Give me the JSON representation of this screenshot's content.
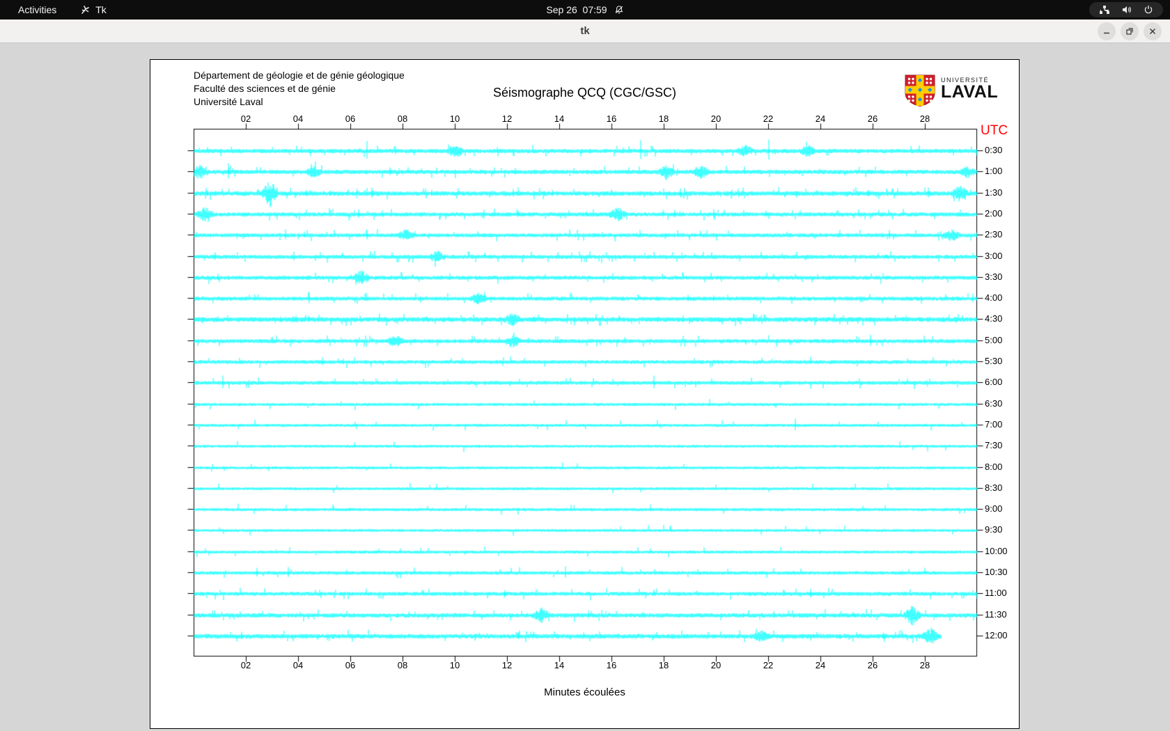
{
  "panel": {
    "activities": "Activities",
    "app_name": "Tk",
    "clock": "Sep 26  07:59"
  },
  "window": {
    "title": "tk"
  },
  "header": {
    "line1": "Département de géologie et de génie géologique",
    "line2": "Faculté des sciences et de génie",
    "line3": "Université Laval"
  },
  "logo": {
    "small": "UNIVERSITÉ",
    "large": "LAVAL"
  },
  "plot": {
    "title": "Séismographe QCQ (CGC/GSC)",
    "utc_label": "UTC",
    "xlabel": "Minutes écoulées",
    "colors": {
      "trace": "#00ffff",
      "utc": "#ff0000",
      "axis": "#000000"
    }
  },
  "chart_data": {
    "type": "seismograph-heliplot",
    "title": "Séismographe QCQ (CGC/GSC)",
    "xlabel": "Minutes écoulées",
    "x_range_minutes": [
      0,
      30
    ],
    "x_tick_labels": [
      "02",
      "04",
      "06",
      "08",
      "10",
      "12",
      "14",
      "16",
      "18",
      "20",
      "22",
      "24",
      "26",
      "28"
    ],
    "y_axis_right_label": "UTC",
    "trace_color": "#00ffff",
    "rows": [
      {
        "label": "0:30",
        "noise": 1.5,
        "micro": 0.05,
        "events": [
          [
            6.6,
            14,
            "s"
          ],
          [
            7.7,
            6,
            "s"
          ],
          [
            10.0,
            5,
            "b"
          ],
          [
            17.1,
            15,
            "s"
          ],
          [
            21.1,
            4,
            "b"
          ],
          [
            22.0,
            16,
            "s"
          ],
          [
            23.5,
            4,
            "b"
          ]
        ]
      },
      {
        "label": "1:00",
        "noise": 1.5,
        "micro": 0.05,
        "events": [
          [
            0.2,
            5,
            "b"
          ],
          [
            1.3,
            12,
            "s"
          ],
          [
            4.6,
            4,
            "b"
          ],
          [
            7.5,
            6,
            "s"
          ],
          [
            18.1,
            5,
            "b"
          ],
          [
            19.4,
            5,
            "b"
          ],
          [
            29.6,
            4,
            "b"
          ]
        ]
      },
      {
        "label": "1:30",
        "noise": 1.7,
        "micro": 0.06,
        "events": [
          [
            0.5,
            5,
            "s"
          ],
          [
            2.9,
            10,
            "b"
          ],
          [
            4.3,
            5,
            "s"
          ],
          [
            5.2,
            4,
            "s"
          ],
          [
            6.8,
            8,
            "s"
          ],
          [
            9.1,
            5,
            "s"
          ],
          [
            12.2,
            6,
            "s"
          ],
          [
            13.7,
            5,
            "s"
          ],
          [
            18.6,
            7,
            "s"
          ],
          [
            25.8,
            5,
            "s"
          ],
          [
            28.1,
            8,
            "s"
          ],
          [
            29.3,
            6,
            "b"
          ]
        ]
      },
      {
        "label": "2:00",
        "noise": 1.5,
        "micro": 0.05,
        "events": [
          [
            0.4,
            5,
            "b"
          ],
          [
            6.3,
            7,
            "s"
          ],
          [
            7.2,
            5,
            "s"
          ],
          [
            11.1,
            6,
            "s"
          ],
          [
            12.4,
            5,
            "s"
          ],
          [
            15.0,
            4,
            "s"
          ],
          [
            16.2,
            5,
            "b"
          ],
          [
            18.4,
            6,
            "s"
          ],
          [
            19.9,
            7,
            "s"
          ],
          [
            21.9,
            5,
            "s"
          ]
        ]
      },
      {
        "label": "2:30",
        "noise": 1.4,
        "micro": 0.04,
        "events": [
          [
            3.5,
            8,
            "s"
          ],
          [
            4.2,
            5,
            "s"
          ],
          [
            6.6,
            8,
            "s"
          ],
          [
            8.1,
            4,
            "b"
          ],
          [
            26.6,
            7,
            "s"
          ],
          [
            29.0,
            4,
            "b"
          ]
        ]
      },
      {
        "label": "3:00",
        "noise": 1.4,
        "micro": 0.04,
        "events": [
          [
            0.8,
            6,
            "s"
          ],
          [
            3.8,
            7,
            "s"
          ],
          [
            9.3,
            4,
            "b"
          ],
          [
            26.5,
            3,
            "s"
          ]
        ]
      },
      {
        "label": "3:30",
        "noise": 1.4,
        "micro": 0.04,
        "events": [
          [
            0.9,
            5,
            "s"
          ],
          [
            6.0,
            4,
            "s"
          ],
          [
            6.4,
            5,
            "b"
          ]
        ]
      },
      {
        "label": "4:00",
        "noise": 1.4,
        "micro": 0.04,
        "events": [
          [
            4.4,
            9,
            "s"
          ],
          [
            10.9,
            4,
            "b"
          ],
          [
            18.9,
            5,
            "s"
          ],
          [
            19.9,
            4,
            "s"
          ],
          [
            29.8,
            7,
            "s"
          ]
        ]
      },
      {
        "label": "4:30",
        "noise": 1.8,
        "micro": 0.07,
        "events": [
          [
            3.3,
            4,
            "s"
          ],
          [
            3.9,
            5,
            "s"
          ],
          [
            4.4,
            4,
            "s"
          ],
          [
            12.2,
            4,
            "b"
          ],
          [
            13.0,
            4,
            "s"
          ]
        ]
      },
      {
        "label": "5:00",
        "noise": 1.4,
        "micro": 0.04,
        "events": [
          [
            7.7,
            4,
            "b"
          ],
          [
            12.2,
            4,
            "b"
          ],
          [
            25.9,
            9,
            "s"
          ]
        ]
      },
      {
        "label": "5:30",
        "noise": 1.3,
        "micro": 0.03,
        "events": [
          [
            4.9,
            6,
            "s"
          ],
          [
            5.7,
            4,
            "s"
          ]
        ]
      },
      {
        "label": "6:00",
        "noise": 1.3,
        "micro": 0.03,
        "events": [
          [
            1.1,
            10,
            "s"
          ],
          [
            17.6,
            10,
            "s"
          ]
        ]
      },
      {
        "label": "6:30",
        "noise": 1.0,
        "micro": 0.015,
        "events": []
      },
      {
        "label": "7:00",
        "noise": 1.0,
        "micro": 0.015,
        "events": [
          [
            23.0,
            9,
            "s"
          ]
        ]
      },
      {
        "label": "7:30",
        "noise": 0.9,
        "micro": 0.01,
        "events": []
      },
      {
        "label": "8:00",
        "noise": 0.9,
        "micro": 0.01,
        "events": []
      },
      {
        "label": "8:30",
        "noise": 0.9,
        "micro": 0.01,
        "events": []
      },
      {
        "label": "9:00",
        "noise": 1.0,
        "micro": 0.012,
        "events": []
      },
      {
        "label": "9:30",
        "noise": 0.9,
        "micro": 0.01,
        "events": []
      },
      {
        "label": "10:00",
        "noise": 1.0,
        "micro": 0.015,
        "events": []
      },
      {
        "label": "10:30",
        "noise": 1.2,
        "micro": 0.03,
        "events": [
          [
            2.4,
            7,
            "s"
          ],
          [
            3.6,
            8,
            "s"
          ],
          [
            14.2,
            9,
            "s"
          ]
        ]
      },
      {
        "label": "11:00",
        "noise": 1.4,
        "micro": 0.04,
        "events": [
          [
            11.9,
            5,
            "s"
          ],
          [
            23.6,
            7,
            "s"
          ]
        ]
      },
      {
        "label": "11:30",
        "noise": 1.6,
        "micro": 0.05,
        "events": [
          [
            13.3,
            5,
            "b"
          ],
          [
            15.1,
            6,
            "s"
          ],
          [
            27.5,
            7,
            "b"
          ]
        ]
      },
      {
        "label": "12:00",
        "noise": 1.7,
        "micro": 0.05,
        "end_minute": 28.6,
        "events": [
          [
            1.8,
            6,
            "s"
          ],
          [
            12.4,
            5,
            "s"
          ],
          [
            14.9,
            5,
            "s"
          ],
          [
            21.7,
            4,
            "b"
          ],
          [
            26.4,
            5,
            "s"
          ],
          [
            28.2,
            6,
            "b"
          ]
        ]
      }
    ]
  }
}
